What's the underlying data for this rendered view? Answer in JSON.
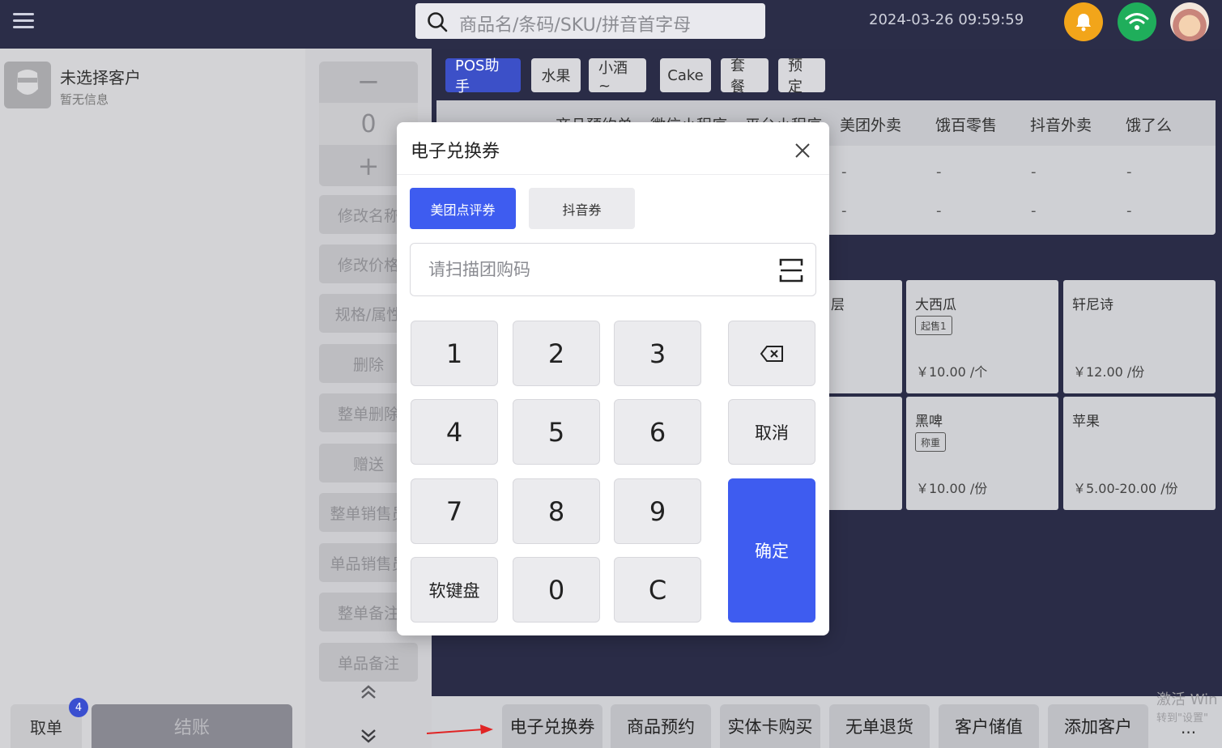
{
  "topbar": {
    "search_placeholder": "商品名/条码/SKU/拼音首字母",
    "datetime": "2024-03-26 09:59:59"
  },
  "customer": {
    "name": "未选择客户",
    "info": "暂无信息"
  },
  "quantity": {
    "minus": "−",
    "value": "0",
    "plus": "+"
  },
  "actions": [
    "修改名称",
    "修改价格",
    "规格/属性",
    "删除",
    "整单删除",
    "赠送",
    "整单销售员",
    "单品销售员",
    "整单备注",
    "单品备注"
  ],
  "left_bottom": {
    "take_order": "取单",
    "badge": "4",
    "checkout": "结账"
  },
  "category_tabs": [
    "POS助手",
    "水果",
    "小酒 ~",
    "Cake",
    "套餐",
    "预定"
  ],
  "order_table": {
    "headers": [
      "商品预约单",
      "微信小程序",
      "平台小程序",
      "美团外卖",
      "饿百零售",
      "抖音外卖",
      "饿了么"
    ],
    "rows": [
      [
        "-",
        "-",
        "-",
        "-"
      ],
      [
        "-",
        "-",
        "-",
        "-"
      ]
    ]
  },
  "products": [
    {
      "name": "层",
      "tag": "",
      "price": ""
    },
    {
      "name": "大西瓜",
      "tag": "起售1",
      "price": "￥10.00 /个"
    },
    {
      "name": "轩尼诗",
      "tag": "",
      "price": "￥12.00 /份"
    },
    {
      "name": "黑啤",
      "tag": "称重",
      "price": "￥10.00 /份"
    },
    {
      "name": "苹果",
      "tag": "",
      "price": "￥5.00-20.00 /份"
    }
  ],
  "bottom_bar": [
    "电子兑换券",
    "商品预约",
    "实体卡购买",
    "无单退货",
    "客户储值",
    "添加客户"
  ],
  "more": "···",
  "windows_activation": {
    "line1": "激活 Win",
    "line2": "转到\"设置\""
  },
  "modal": {
    "title": "电子兑换券",
    "tabs": [
      "美团点评券",
      "抖音券"
    ],
    "input_placeholder": "请扫描团购码",
    "keys": [
      "1",
      "2",
      "3",
      "4",
      "5",
      "6",
      "7",
      "8",
      "9",
      "软键盘",
      "0",
      "C"
    ],
    "cancel": "取消",
    "confirm": "确定"
  },
  "colors": {
    "primary": "#3e5cf0",
    "bell": "#f2a51a",
    "wifi": "#1fae5b",
    "topbar": "#2b2d48"
  },
  "icons": [
    "menu-icon",
    "search-icon",
    "bell-icon",
    "wifi-icon",
    "close-icon",
    "scan-icon",
    "backspace-icon",
    "chevron-up-icon",
    "chevron-down-icon"
  ]
}
